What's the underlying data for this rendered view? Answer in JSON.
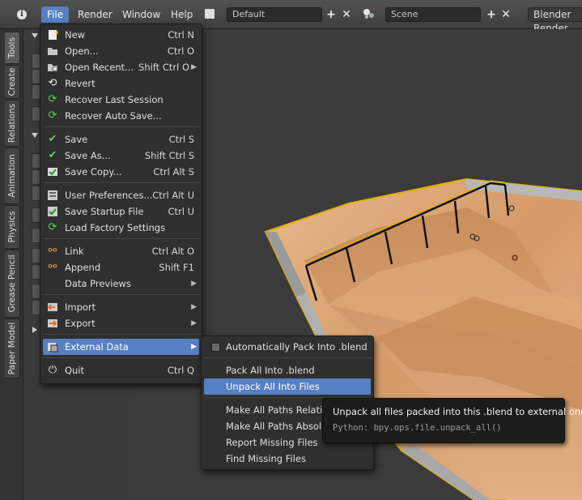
{
  "topbar": {
    "menus": [
      "File",
      "Render",
      "Window",
      "Help"
    ],
    "layout_name": "Default",
    "scene_name": "Scene",
    "renderer": "Blender Render"
  },
  "tabs": [
    "Tools",
    "Create",
    "Relations",
    "Animation",
    "Physics",
    "Grease Pencil",
    "Paper Model"
  ],
  "file_menu": {
    "items": [
      {
        "label": "New",
        "shortcut": "Ctrl N",
        "icon": "new-file-icon"
      },
      {
        "label": "Open...",
        "shortcut": "Ctrl O",
        "icon": "folder-icon"
      },
      {
        "label": "Open Recent...",
        "shortcut": "Shift Ctrl O",
        "icon": "open-recent-icon",
        "submenu": true
      },
      {
        "label": "Revert",
        "shortcut": "",
        "icon": "revert-icon"
      },
      {
        "label": "Recover Last Session",
        "shortcut": "",
        "icon": "recover-icon"
      },
      {
        "label": "Recover Auto Save...",
        "shortcut": "",
        "icon": "recover-auto-icon"
      },
      {
        "label": "Save",
        "shortcut": "Ctrl S",
        "icon": "checkmark-icon"
      },
      {
        "label": "Save As...",
        "shortcut": "Shift Ctrl S",
        "icon": "save-as-icon"
      },
      {
        "label": "Save Copy...",
        "shortcut": "Ctrl Alt S",
        "icon": "save-copy-icon"
      },
      {
        "label": "User Preferences...",
        "shortcut": "Ctrl Alt U",
        "icon": "preferences-icon"
      },
      {
        "label": "Save Startup File",
        "shortcut": "Ctrl U",
        "icon": "save-startup-icon"
      },
      {
        "label": "Load Factory Settings",
        "shortcut": "",
        "icon": "factory-settings-icon"
      },
      {
        "label": "Link",
        "shortcut": "Ctrl Alt O",
        "icon": "link-icon"
      },
      {
        "label": "Append",
        "shortcut": "Shift F1",
        "icon": "append-icon"
      },
      {
        "label": "Data Previews",
        "shortcut": "",
        "icon": "",
        "submenu": true
      },
      {
        "label": "Import",
        "shortcut": "",
        "icon": "import-icon",
        "submenu": true
      },
      {
        "label": "Export",
        "shortcut": "",
        "icon": "export-icon",
        "submenu": true
      },
      {
        "label": "External Data",
        "shortcut": "",
        "icon": "external-data-icon",
        "submenu": true,
        "highlighted": true
      },
      {
        "label": "Quit",
        "shortcut": "Ctrl Q",
        "icon": "power-icon"
      }
    ]
  },
  "external_data_menu": {
    "items": [
      {
        "label": "Automatically Pack Into .blend",
        "checkbox": true
      },
      {
        "label": "Pack All Into .blend"
      },
      {
        "label": "Unpack All Into Files",
        "highlighted": true
      },
      {
        "label": "Make All Paths Relative"
      },
      {
        "label": "Make All Paths Absolute"
      },
      {
        "label": "Report Missing Files"
      },
      {
        "label": "Find Missing Files"
      }
    ]
  },
  "tooltip": {
    "description": "Unpack all files packed into this .blend to external ones",
    "python": "Python: bpy.ops.file.unpack_all()"
  },
  "colors": {
    "highlight": "#5680c2",
    "menu_bg": "#2f2f2f",
    "object_outline": "#e0b000"
  }
}
